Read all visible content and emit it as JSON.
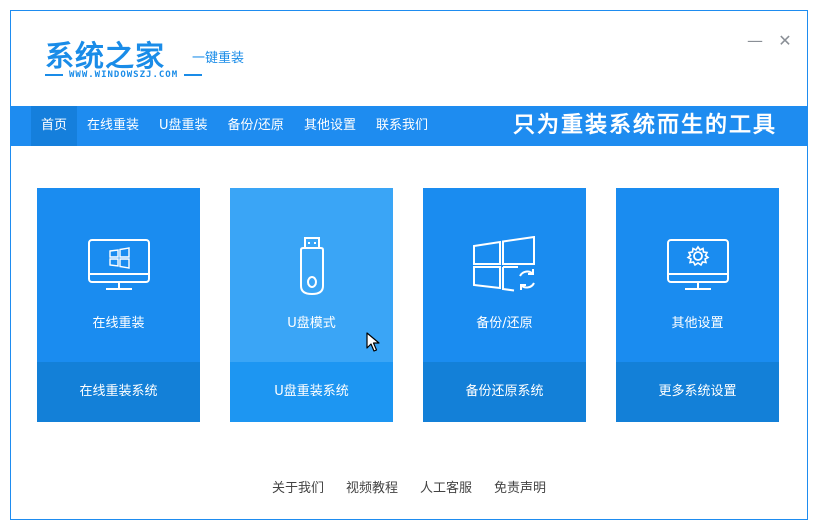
{
  "logo": {
    "title": "系统之家",
    "subtitle": "一键重装",
    "url": "WWW.WINDOWSZJ.COM"
  },
  "window_controls": {
    "minimize": "—",
    "close": "✕"
  },
  "nav": {
    "items": [
      {
        "label": "首页",
        "active": true
      },
      {
        "label": "在线重装"
      },
      {
        "label": "U盘重装"
      },
      {
        "label": "备份/还原"
      },
      {
        "label": "其他设置"
      },
      {
        "label": "联系我们"
      }
    ],
    "slogan": "只为重装系统而生的工具"
  },
  "cards": [
    {
      "icon": "monitor-windows-icon",
      "label": "在线重装",
      "action": "在线重装系统"
    },
    {
      "icon": "usb-drive-icon",
      "label": "U盘模式",
      "action": "U盘重装系统",
      "hovered": true
    },
    {
      "icon": "windows-restore-icon",
      "label": "备份/还原",
      "action": "备份还原系统"
    },
    {
      "icon": "monitor-gear-icon",
      "label": "其他设置",
      "action": "更多系统设置"
    }
  ],
  "footer": {
    "links": [
      "关于我们",
      "视频教程",
      "人工客服",
      "免责声明"
    ]
  },
  "colors": {
    "brand": "#1e8cf0",
    "card": "#1a8cf0",
    "card_hover": "#3aa5f6",
    "card_bottom": "#1380d8"
  }
}
